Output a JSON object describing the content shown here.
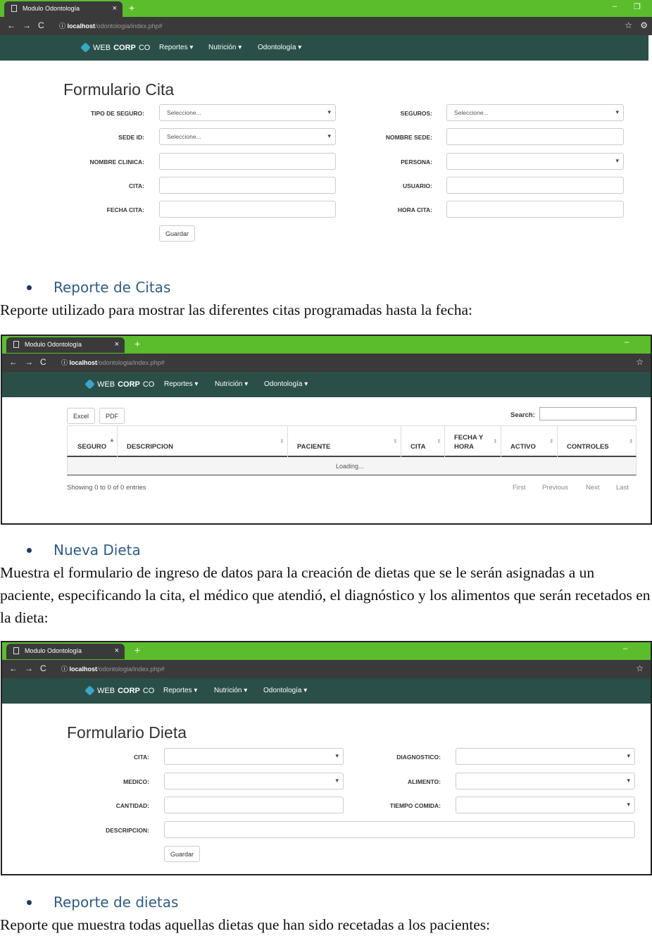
{
  "browser": {
    "tab_title": "Modulo Odontología",
    "url_host": "localhost",
    "url_path": "/odontologia/index.php#"
  },
  "navbar": {
    "brand_prefix": "WEB",
    "brand_bold": "CORP",
    "brand_suffix": "CO",
    "menu": [
      "Reportes ▾",
      "Nutrición ▾",
      "Odontología ▾"
    ]
  },
  "cita_form": {
    "title": "Formulario Cita",
    "left": [
      {
        "label": "TIPO DE SEGURO:",
        "value": "Seleccione..."
      },
      {
        "label": "SEDE ID:",
        "value": "Seleccione..."
      },
      {
        "label": "NOMBRE CLINICA:",
        "value": ""
      },
      {
        "label": "CITA:",
        "value": ""
      },
      {
        "label": "FECHA CITA:",
        "value": ""
      }
    ],
    "right": [
      {
        "label": "SEGUROS:",
        "value": "Seleccione..."
      },
      {
        "label": "NOMBRE SEDE:",
        "value": ""
      },
      {
        "label": "PERSONA:",
        "value": ""
      },
      {
        "label": "USUARIO:",
        "value": ""
      },
      {
        "label": "HORA CITA:",
        "value": ""
      }
    ],
    "save_label": "Guardar"
  },
  "section1": {
    "heading": "Reporte de Citas",
    "text": "Reporte utilizado para mostrar las diferentes citas programadas hasta la fecha:"
  },
  "report_citas": {
    "buttons": [
      "Excel",
      "PDF"
    ],
    "search_label": "Search:",
    "columns": [
      "SEGURO",
      "DESCRIPCION",
      "PACIENTE",
      "CITA",
      "FECHA Y HORA",
      "ACTIVO",
      "CONTROLES"
    ],
    "loading": "Loading...",
    "info": "Showing 0 to 0 of 0 entries",
    "pager": [
      "First",
      "Previous",
      "Next",
      "Last"
    ]
  },
  "section2": {
    "heading": "Nueva Dieta",
    "text": "Muestra el formulario de ingreso de datos para la creación de dietas que se le serán asignadas a un paciente, especificando la cita, el médico que atendió, el diagnóstico y los alimentos que serán recetados en la dieta:"
  },
  "dieta_form": {
    "title": "Formulario Dieta",
    "left": [
      {
        "label": "CITA:"
      },
      {
        "label": "MEDICO:"
      },
      {
        "label": "CANTIDAD:"
      },
      {
        "label": "DESCRIPCION:"
      }
    ],
    "right": [
      {
        "label": "DIAGNOSTICO:"
      },
      {
        "label": "ALIMENTO:"
      },
      {
        "label": "TIEMPO COMIDA:"
      }
    ],
    "save_label": "Guardar"
  },
  "section3": {
    "heading": "Reporte de dietas",
    "text": "Reporte que muestra todas aquellas dietas que han sido recetadas a los pacientes:"
  }
}
